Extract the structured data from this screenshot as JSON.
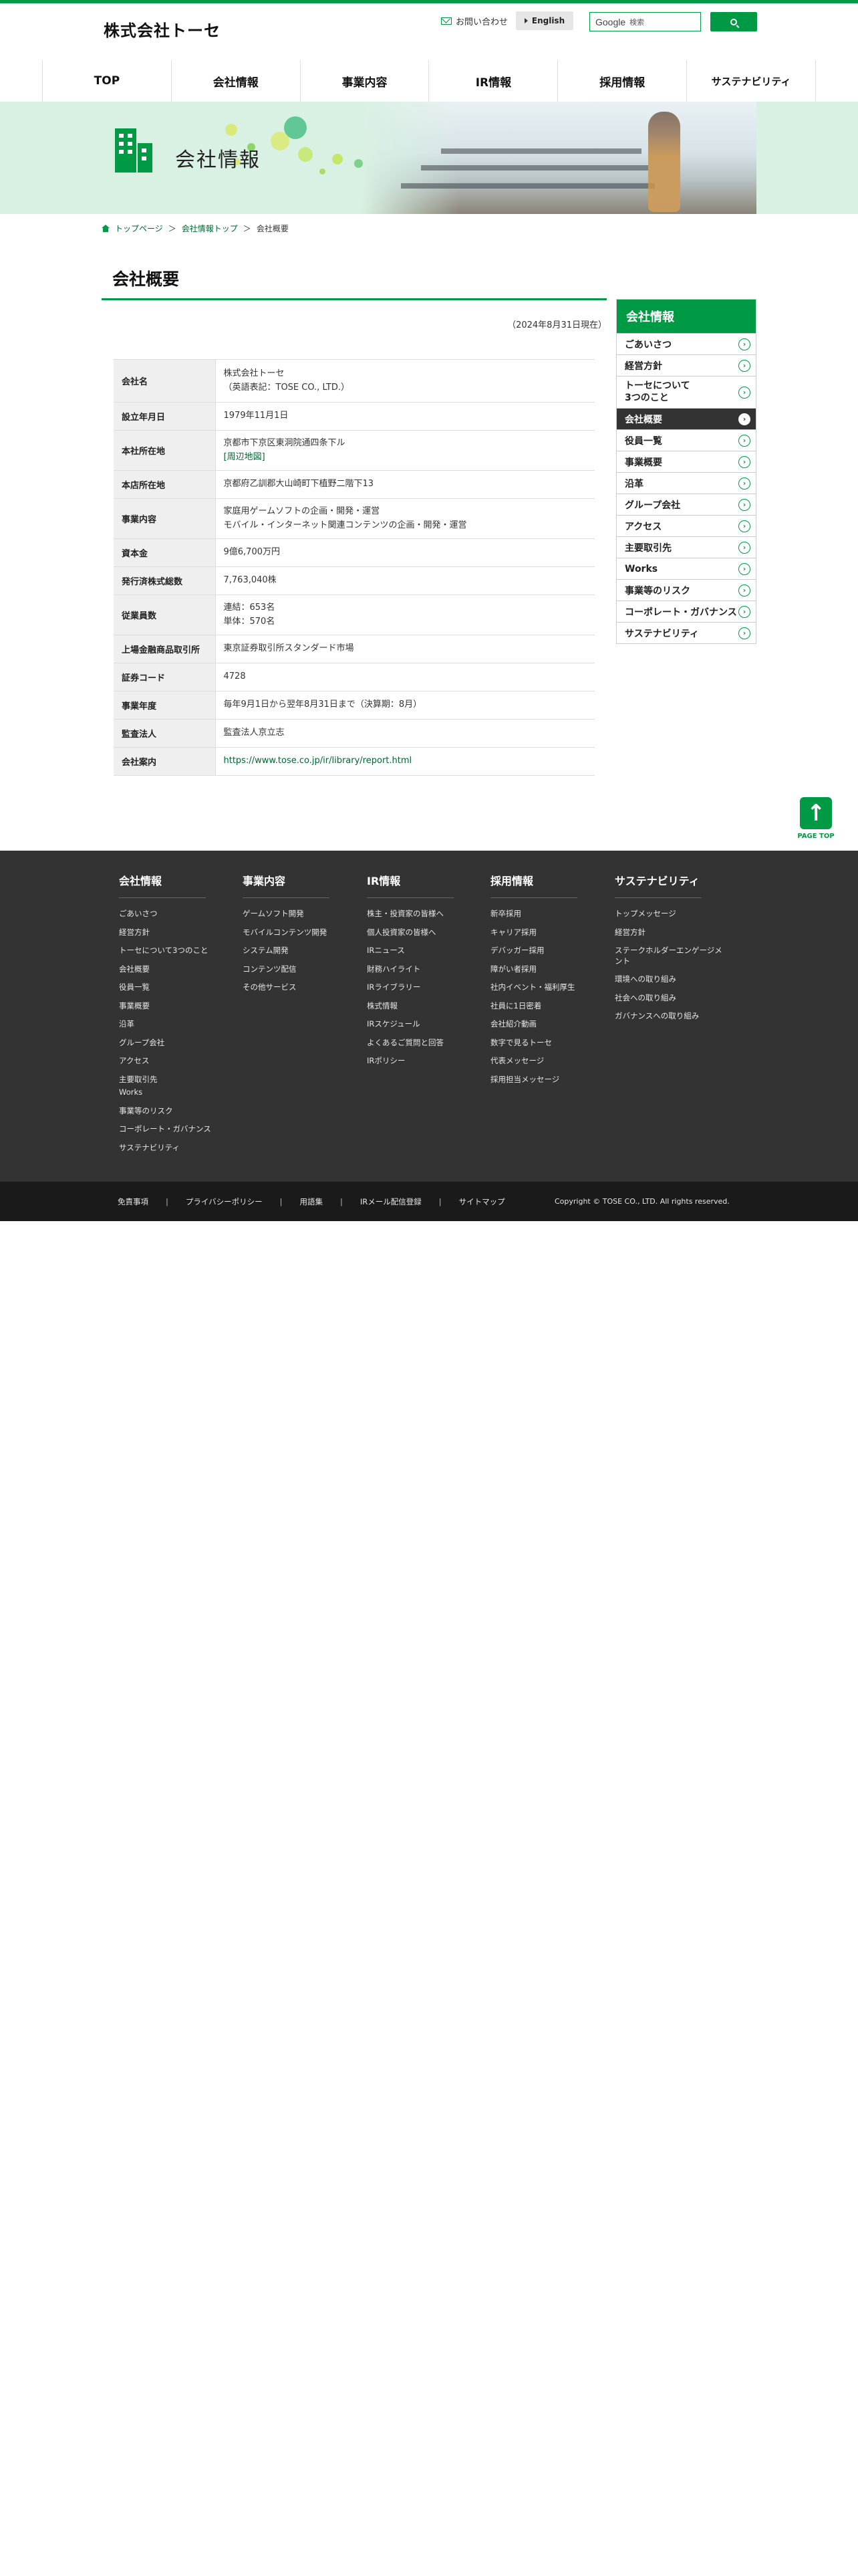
{
  "header": {
    "logo": "株式会社トーセ",
    "contact_label": "お問い合わせ",
    "lang_label": "English",
    "search": {
      "brand": "Google",
      "placeholder": "検索"
    }
  },
  "gnav": [
    "TOP",
    "会社情報",
    "事業内容",
    "IR情報",
    "採用情報",
    "サステナビリティ"
  ],
  "banner": {
    "title": "会社情報"
  },
  "breadcrumb": {
    "home": "トップページ",
    "parent": "会社情報トップ",
    "current": "会社概要",
    "sep": "＞"
  },
  "main": {
    "title": "会社概要",
    "as_of": "（2024年8月31日現在）",
    "rows": [
      {
        "label": "会社名",
        "lines": [
          "株式会社トーセ",
          "（英語表記：TOSE CO., LTD.）"
        ]
      },
      {
        "label": "設立年月日",
        "lines": [
          "1979年11月1日"
        ]
      },
      {
        "label": "本社所在地",
        "lines": [
          "京都市下京区東洞院通四条下ル"
        ],
        "link": "[周辺地図]"
      },
      {
        "label": "本店所在地",
        "lines": [
          "京都府乙訓郡大山崎町下植野二階下13"
        ]
      },
      {
        "label": "事業内容",
        "lines": [
          "家庭用ゲームソフトの企画・開発・運営",
          "モバイル・インターネット関連コンテンツの企画・開発・運営"
        ]
      },
      {
        "label": "資本金",
        "lines": [
          "9億6,700万円"
        ]
      },
      {
        "label": "発行済株式総数",
        "lines": [
          "7,763,040株"
        ]
      },
      {
        "label": "従業員数",
        "lines": [
          "連結：653名",
          "単体：570名"
        ]
      },
      {
        "label": "上場金融商品取引所",
        "lines": [
          "東京証券取引所スタンダード市場"
        ]
      },
      {
        "label": "証券コード",
        "lines": [
          "4728"
        ]
      },
      {
        "label": "事業年度",
        "lines": [
          "毎年9月1日から翌年8月31日まで（決算期：8月）"
        ]
      },
      {
        "label": "監査法人",
        "lines": [
          "監査法人京立志"
        ]
      },
      {
        "label": "会社案内",
        "lines": [],
        "link": "https://www.tose.co.jp/ir/library/report.html"
      }
    ]
  },
  "sidenav": {
    "title": "会社情報",
    "items": [
      {
        "label": "ごあいさつ"
      },
      {
        "label": "経営方針"
      },
      {
        "label": "トーセについて\n3つのこと",
        "tall": true
      },
      {
        "label": "会社概要",
        "active": true
      },
      {
        "label": "役員一覧"
      },
      {
        "label": "事業概要"
      },
      {
        "label": "沿革"
      },
      {
        "label": "グループ会社"
      },
      {
        "label": "アクセス"
      },
      {
        "label": "主要取引先"
      },
      {
        "label": "Works"
      },
      {
        "label": "事業等のリスク"
      },
      {
        "label": "コーポレート・ガバナンス"
      },
      {
        "label": "サステナビリティ"
      }
    ]
  },
  "pagetop": {
    "label": "PAGE TOP"
  },
  "footer": {
    "columns": [
      {
        "title": "会社情報",
        "items": [
          "ごあいさつ",
          "経営方針",
          "トーセについて3つのこと",
          "会社概要",
          "役員一覧",
          "事業概要",
          "沿革",
          "グループ会社",
          "アクセス",
          "主要取引先",
          "Works",
          "事業等のリスク",
          "コーポレート・ガバナンス",
          "サステナビリティ"
        ]
      },
      {
        "title": "事業内容",
        "items": [
          "ゲームソフト開発",
          "モバイルコンテンツ開発",
          "システム開発",
          "コンテンツ配信",
          "その他サービス"
        ]
      },
      {
        "title": "IR情報",
        "items": [
          "株主・投資家の皆様へ",
          "個人投資家の皆様へ",
          "IRニュース",
          "財務ハイライト",
          "IRライブラリー",
          "株式情報",
          "IRスケジュール",
          "よくあるご質問と回答",
          "IRポリシー"
        ]
      },
      {
        "title": "採用情報",
        "items": [
          "新卒採用",
          "キャリア採用",
          "デバッガー採用",
          "障がい者採用",
          "社内イベント・福利厚生",
          "社員に1日密着",
          "会社紹介動画",
          "数字で見るトーセ",
          "代表メッセージ",
          "採用担当メッセージ"
        ]
      },
      {
        "title": "サステナビリティ",
        "items": [
          "トップメッセージ",
          "経営方針",
          "ステークホルダーエンゲージメント",
          "環境への取り組み",
          "社会への取り組み",
          "ガバナンスへの取り組み"
        ]
      }
    ],
    "bottom_links": [
      "免責事項",
      "プライバシーポリシー",
      "用語集",
      "IRメール配信登録",
      "サイトマップ"
    ],
    "copyright": "Copyright © TOSE CO., LTD. All rights reserved."
  },
  "colors": {
    "brand": "#009944",
    "footer": "#333333",
    "footer_bar": "#1a1a1a",
    "banner_bg": "#d9f1e2"
  }
}
